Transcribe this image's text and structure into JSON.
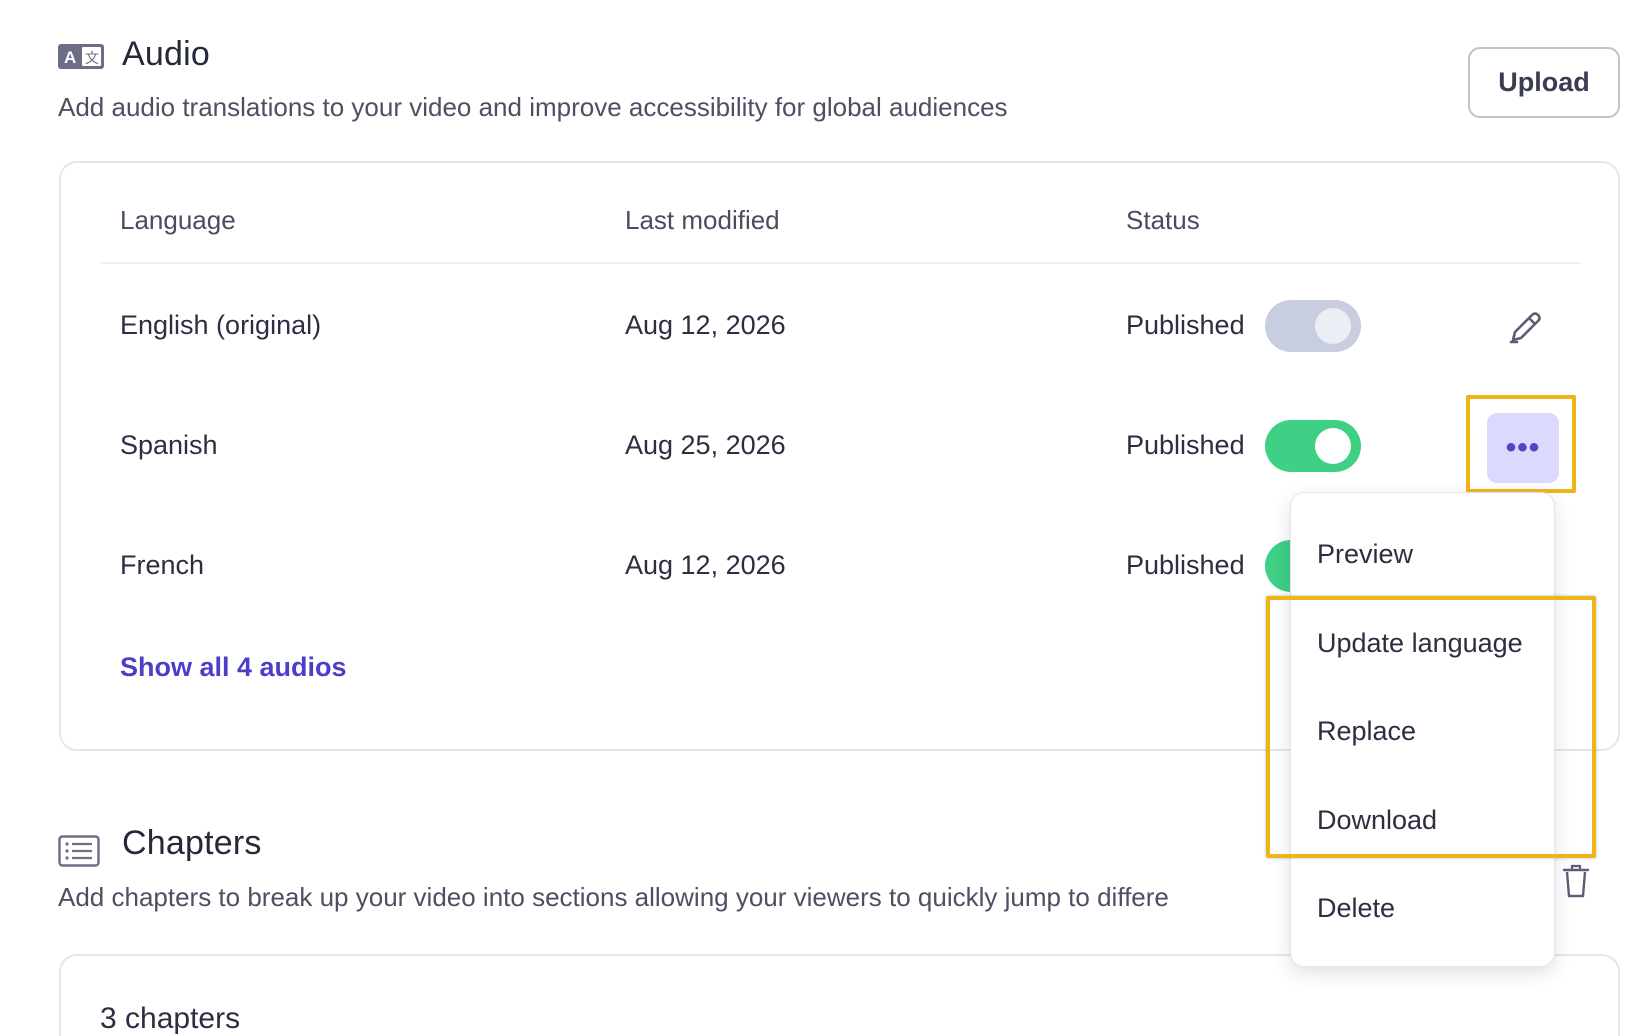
{
  "audio": {
    "title": "Audio",
    "description": "Add audio translations to your video and improve accessibility for global audiences",
    "upload_label": "Upload",
    "icon": "translate-icon",
    "table": {
      "columns": [
        "Language",
        "Last modified",
        "Status"
      ],
      "rows": [
        {
          "language": "English (original)",
          "modified": "Aug 12, 2026",
          "status": "Published",
          "enabled": false
        },
        {
          "language": "Spanish",
          "modified": "Aug 25, 2026",
          "status": "Published",
          "enabled": true
        },
        {
          "language": "French",
          "modified": "Aug 12, 2026",
          "status": "Published",
          "enabled": true
        }
      ]
    },
    "show_all_label": "Show all 4 audios",
    "more_label": "•••"
  },
  "menu": {
    "items": [
      "Preview",
      "Update language",
      "Replace",
      "Download",
      "Delete"
    ]
  },
  "chapters": {
    "title": "Chapters",
    "description": "Add chapters to break up your video into sections allowing your viewers to quickly jump to differe",
    "icon": "list-icon",
    "count_label": "3 chapters"
  },
  "colors": {
    "accent": "#4b3fc9",
    "toggle_on": "#3fcf85",
    "toggle_off": "#c9cde0",
    "highlight": "#f0b41b",
    "more_button_bg": "#dcd9ff"
  }
}
